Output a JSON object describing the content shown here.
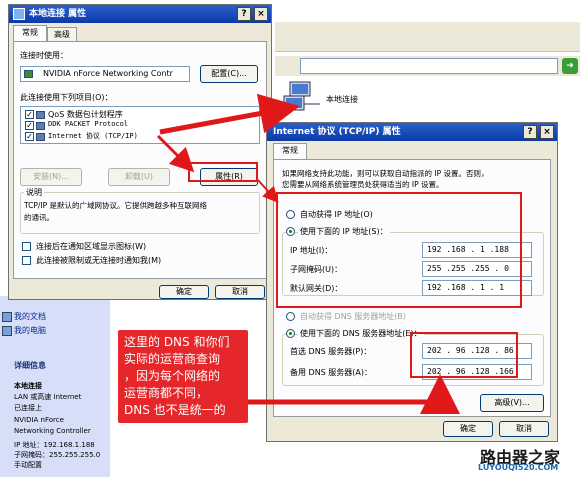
{
  "left_dialog": {
    "title": "本地连接 属性",
    "tabs": [
      "常规",
      "高级"
    ],
    "connect_using_label": "连接时使用：",
    "adapter_name": "NVIDIA nForce Networking Contr",
    "configure_button": "配置(C)...",
    "items_label": "此连接使用下列项目(O)：",
    "items": [
      "QoS 数据包计划程序",
      "DDK PACKET Protocol",
      "Internet 协议 (TCP/IP)"
    ],
    "install_button": "安装(N)...",
    "uninstall_button": "卸载(U)",
    "properties_button": "属性(R)",
    "description_group": "说明",
    "description_text_1": "TCP/IP 是默认的广域网协议。它提供跨越多种互联网络",
    "description_text_2": "的通讯。",
    "show_icon_checkbox": "连接后在通知区域显示图标(W)",
    "notify_checkbox": "此连接被限制或无连接时通知我(M)",
    "ok_button": "确定",
    "cancel_button": "取消"
  },
  "background": {
    "network_icon_label": "本地连接",
    "sidebar_links": [
      "我的文档",
      "我的电脑"
    ],
    "details_heading": "详细信息",
    "details_lines": [
      "本地连接",
      "LAN 或高速 Internet",
      "已连接上",
      "NVIDIA nForce",
      "Networking Controller",
      "IP 地址：192.168.1.188",
      "子网掩码：255.255.255.0",
      "手动配置"
    ]
  },
  "tcpip_dialog": {
    "title": "Internet 协议 (TCP/IP) 属性",
    "tab": "常规",
    "intro_1": "如果网络支持此功能，则可以获取自动指派的 IP 设置。否则，",
    "intro_2": "您需要从网络系统管理员处获得适当的 IP 设置。",
    "auto_ip_radio": "自动获得 IP 地址(O)",
    "manual_ip_radio": "使用下面的 IP 地址(S)：",
    "ip_label": "IP 地址(I)：",
    "ip_value": "192 .168 . 1  .188",
    "mask_label": "子网掩码(U)：",
    "mask_value": "255 .255 .255 . 0",
    "gateway_label": "默认网关(D)：",
    "gateway_value": "192 .168 . 1  . 1",
    "auto_dns_radio": "自动获得 DNS 服务器地址(B)",
    "manual_dns_radio": "使用下面的 DNS 服务器地址(E)：",
    "dns1_label": "首选 DNS 服务器(P)：",
    "dns1_value": "202 . 96 .128 . 86",
    "dns2_label": "备用 DNS 服务器(A)：",
    "dns2_value": "202 . 96 .128 .166",
    "advanced_button": "高级(V)...",
    "ok_button": "确定",
    "cancel_button": "取消"
  },
  "callout": {
    "lines": [
      "这里的 DNS 和你们",
      "实际的运营商查询",
      "，因为每个网络的",
      "运营商都不同，",
      "DNS 也不是统一的"
    ]
  },
  "watermark": {
    "name": "路由器之家",
    "url": "LUYOUQI520.COM"
  },
  "colors": {
    "annotation_red": "#e0181a",
    "xp_title_blue": "#0a3aa8",
    "dialog_face": "#ece9d8"
  }
}
